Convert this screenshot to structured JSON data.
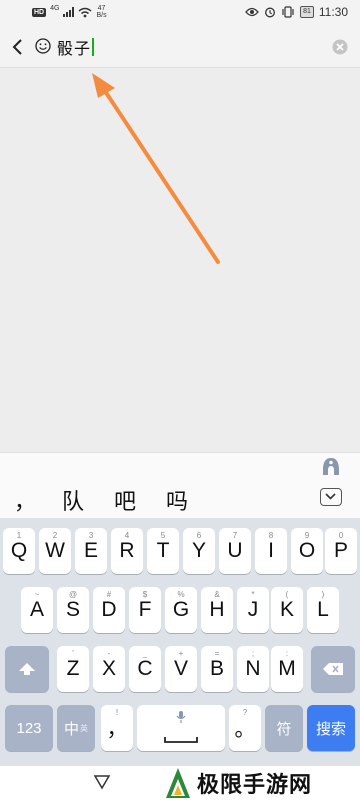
{
  "status_bar": {
    "hd": "HD",
    "network": "4G",
    "speed_value": "47",
    "speed_unit": "B/s",
    "battery": "81",
    "time": "11:30",
    "icons": [
      "eye-icon",
      "alarm-icon",
      "vibrate-icon",
      "battery-icon"
    ]
  },
  "search": {
    "query": "骰子",
    "icons": [
      "back-icon",
      "emoji-icon",
      "clear-icon"
    ]
  },
  "annotation": {
    "color": "#f58b3e"
  },
  "ime": {
    "candidates": [
      "，",
      "队",
      "吧",
      "吗"
    ],
    "rows": [
      {
        "keys": [
          {
            "main": "Q",
            "sub": "1"
          },
          {
            "main": "W",
            "sub": "2"
          },
          {
            "main": "E",
            "sub": "3"
          },
          {
            "main": "R",
            "sub": "4"
          },
          {
            "main": "T",
            "sub": "5"
          },
          {
            "main": "Y",
            "sub": "6"
          },
          {
            "main": "U",
            "sub": "7"
          },
          {
            "main": "I",
            "sub": "8"
          },
          {
            "main": "O",
            "sub": "9"
          },
          {
            "main": "P",
            "sub": "0"
          }
        ]
      },
      {
        "keys": [
          {
            "main": "A",
            "sub": "~"
          },
          {
            "main": "S",
            "sub": "@"
          },
          {
            "main": "D",
            "sub": "#"
          },
          {
            "main": "F",
            "sub": "$"
          },
          {
            "main": "G",
            "sub": "%"
          },
          {
            "main": "H",
            "sub": "&"
          },
          {
            "main": "J",
            "sub": "*"
          },
          {
            "main": "K",
            "sub": "("
          },
          {
            "main": "L",
            "sub": ")"
          }
        ]
      },
      {
        "keys": [
          {
            "main": "Z",
            "sub": "'"
          },
          {
            "main": "X",
            "sub": "-"
          },
          {
            "main": "C",
            "sub": "_"
          },
          {
            "main": "V",
            "sub": "+"
          },
          {
            "main": "B",
            "sub": "="
          },
          {
            "main": "N",
            "sub": ";"
          },
          {
            "main": "M",
            "sub": ":"
          }
        ]
      }
    ],
    "bottom": {
      "num": "123",
      "lang": "中",
      "lang_sub": "英",
      "comma": "，",
      "comma_sub": "!",
      "period": "。",
      "period_sub": "?",
      "symbol": "符",
      "search": "搜索"
    },
    "accent_color": "#3d7cf1"
  },
  "watermark": {
    "text": "极限手游网"
  }
}
